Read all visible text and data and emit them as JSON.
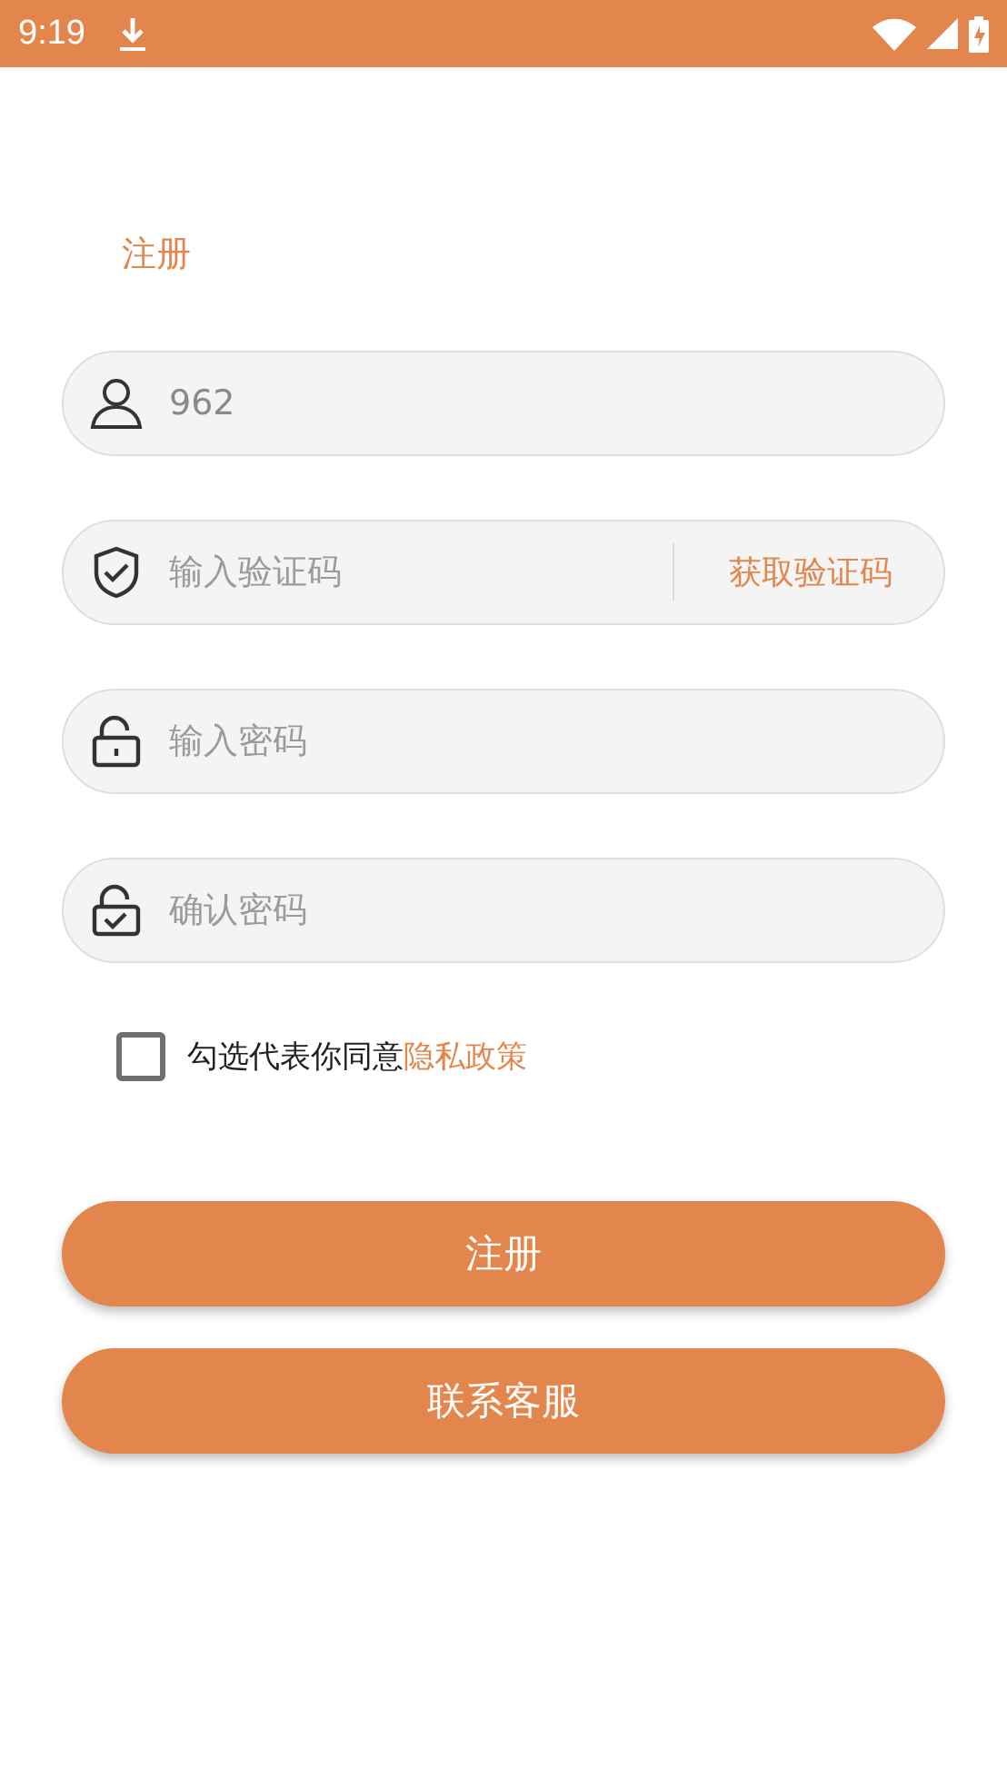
{
  "status_bar": {
    "time": "9:19"
  },
  "title": "注册",
  "fields": [
    {
      "kind": "user",
      "value": "962"
    },
    {
      "kind": "code",
      "placeholder": "输入验证码",
      "action": "获取验证码"
    },
    {
      "kind": "lock",
      "placeholder": "输入密码"
    },
    {
      "kind": "confirm",
      "placeholder": "确认密码"
    }
  ],
  "agreement": {
    "checked": false,
    "text": "勾选代表你同意",
    "link": "隐私政策"
  },
  "buttons": [
    "注册",
    "联系客服"
  ]
}
